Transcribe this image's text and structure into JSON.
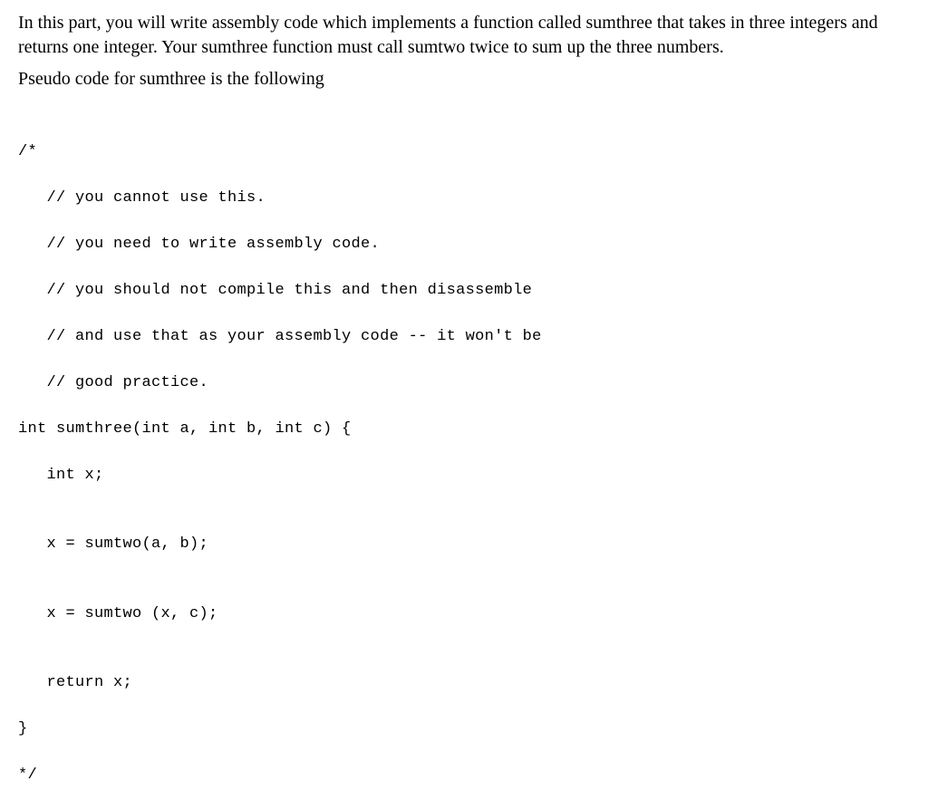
{
  "prose": {
    "para1": "In this part, you will write assembly code which implements a function called sumthree that takes in three integers and returns one integer. Your sumthree function must call sumtwo twice to sum up the three numbers.",
    "para2": "Pseudo code for sumthree is the following"
  },
  "code": {
    "line1": "/*",
    "line2": "   // you cannot use this.",
    "line3": "   // you need to write assembly code.",
    "line4": "   // you should not compile this and then disassemble",
    "line5": "   // and use that as your assembly code -- it won't be",
    "line6": "   // good practice.",
    "line7": "int sumthree(int a, int b, int c) {",
    "line8": "   int x;",
    "line9": "",
    "line10": "   x = sumtwo(a, b);",
    "line11": "",
    "line12": "   x = sumtwo (x, c);",
    "line13": "",
    "line14": "   return x;",
    "line15": "}",
    "line16": "*/"
  }
}
